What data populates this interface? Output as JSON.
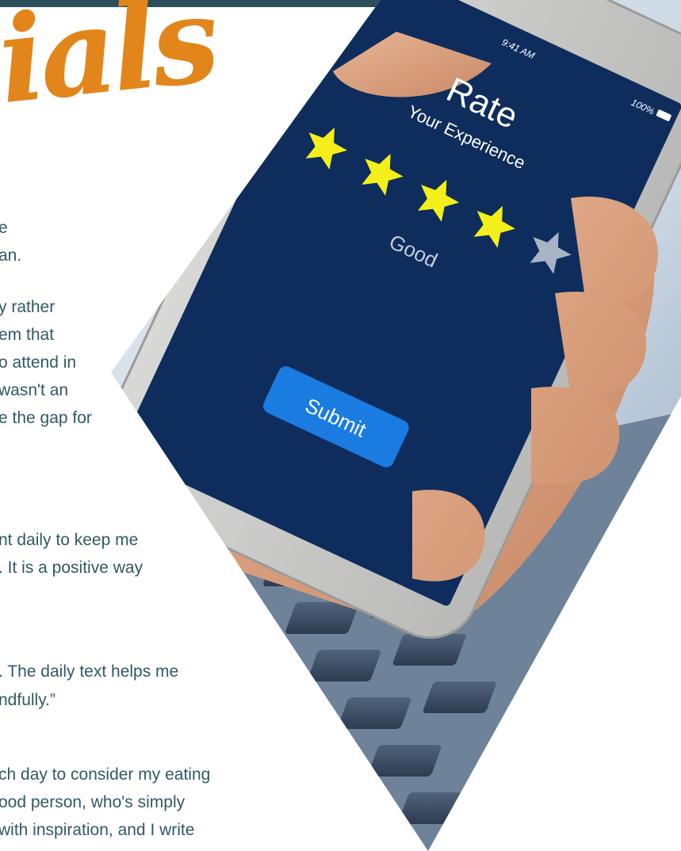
{
  "header": {
    "title": "ials",
    "accent_color": "#e2861b",
    "bar_color": "#2b4f5a"
  },
  "testimonials": {
    "lines": [
      "e",
      "an.",
      "y rather",
      "em that",
      "o attend in",
      " wasn't an",
      "e the gap for",
      "nt daily to keep me",
      ". It is a positive way",
      ". The daily text helps me",
      "ndfully.”",
      "ch day to consider my eating",
      "ood person, who's simply",
      "with inspiration, and I write"
    ],
    "text_color": "#2f5a63"
  },
  "phone": {
    "time": "9:41 AM",
    "battery": "100%",
    "title": "Rate",
    "subtitle": "Your Experience",
    "rating_label": "Good",
    "rating": 4,
    "rating_max": 5,
    "submit_label": "Submit",
    "screen_color": "#0e2d5c",
    "star_color": "#f4ef1a",
    "star_empty_color": "#a7b4c6",
    "button_color": "#1a7be0"
  }
}
